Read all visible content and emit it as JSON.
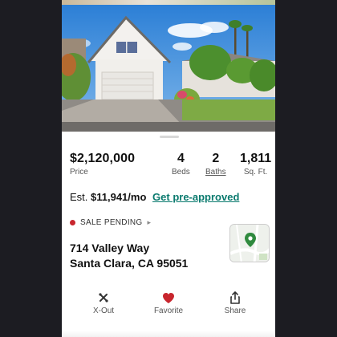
{
  "listing": {
    "price": "$2,120,000",
    "price_label": "Price",
    "beds_value": "4",
    "beds_label": "Beds",
    "baths_value": "2",
    "baths_label": "Baths",
    "sqft_value": "1,811",
    "sqft_label": "Sq. Ft.",
    "estimate_prefix": "Est. ",
    "estimate_amount": "$11,941/mo",
    "preapproved_link": "Get pre-approved",
    "status_label": "SALE PENDING",
    "status_color": "#c8262e",
    "address_line1": "714 Valley Way",
    "address_line2": "Santa Clara, CA 95051"
  },
  "actions": [
    {
      "label": "X-Out",
      "icon": "x-out-icon"
    },
    {
      "label": "Favorite",
      "icon": "heart-icon"
    },
    {
      "label": "Share",
      "icon": "share-icon"
    }
  ],
  "colors": {
    "accent_link": "#0a7a6e",
    "favorite": "#c8262e"
  }
}
